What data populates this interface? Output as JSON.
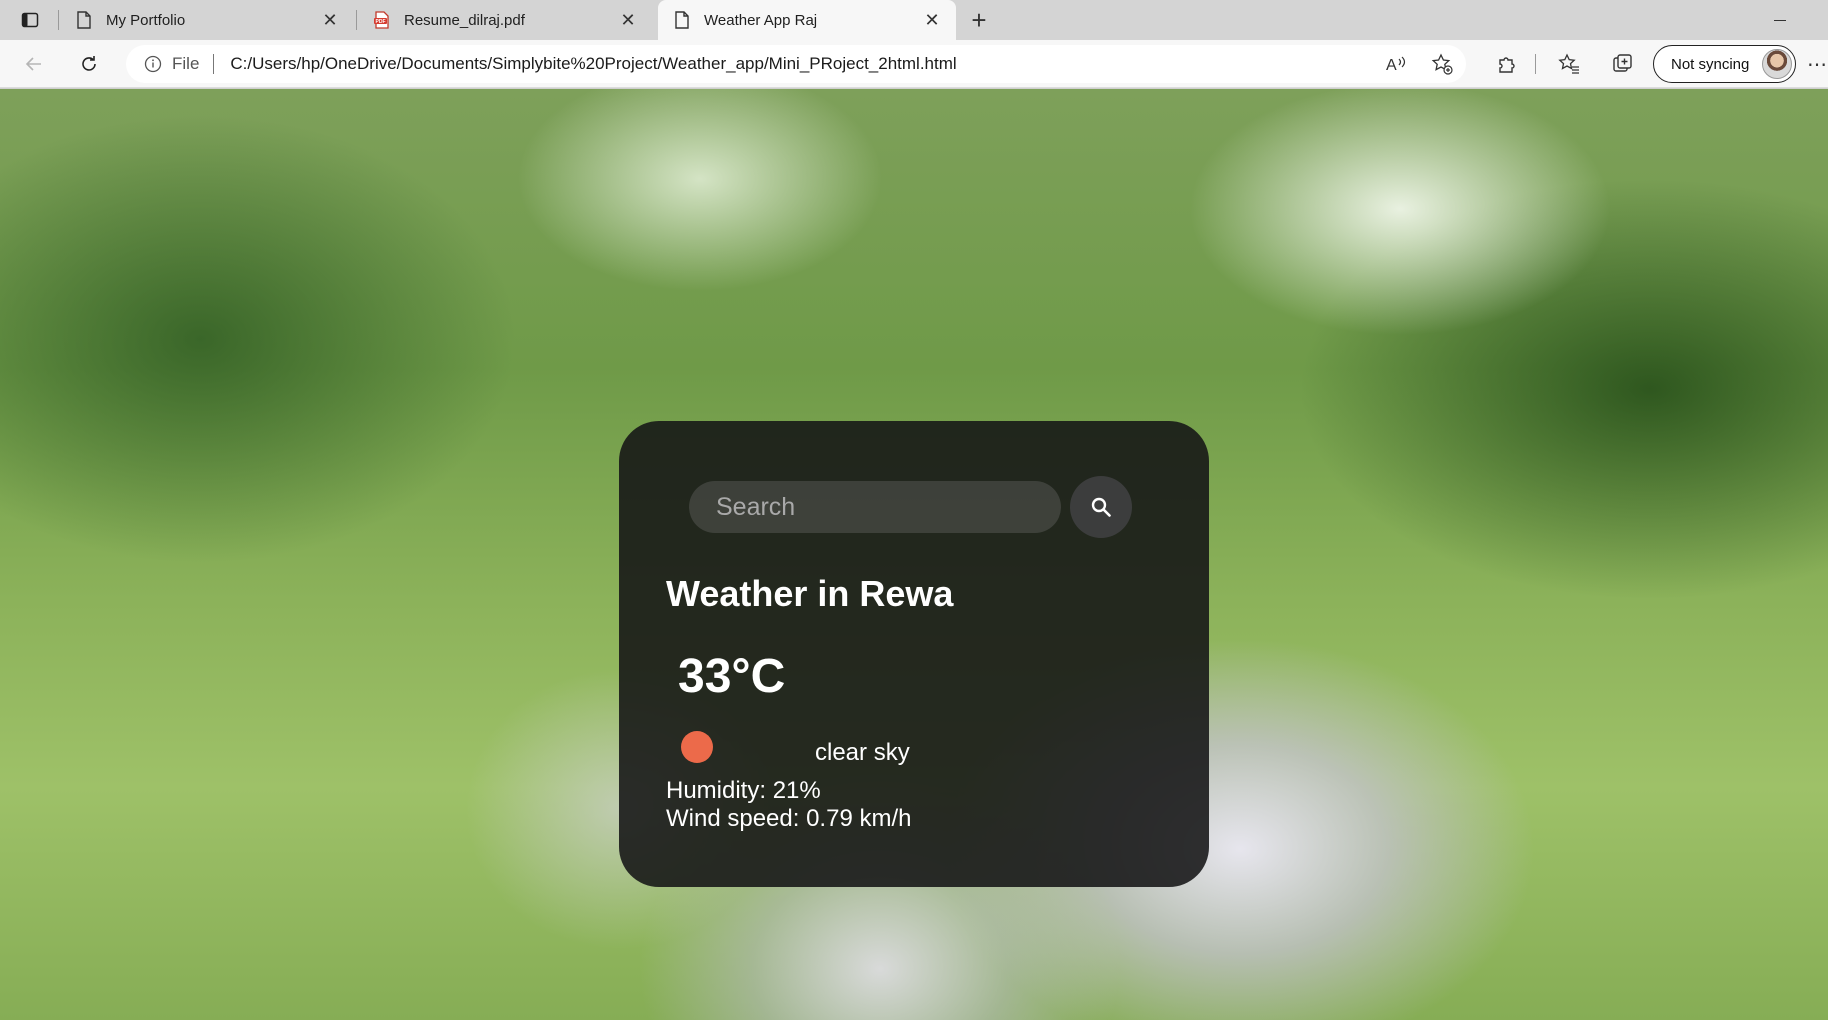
{
  "browser": {
    "tabs": [
      {
        "title": "My Portfolio",
        "icon": "page-icon",
        "active": false
      },
      {
        "title": "Resume_dilraj.pdf",
        "icon": "pdf-icon",
        "active": false
      },
      {
        "title": "Weather App Raj",
        "icon": "page-icon",
        "active": true
      }
    ],
    "address": {
      "scheme_label": "File",
      "url": "C:/Users/hp/OneDrive/Documents/Simplybite%20Project/Weather_app/Mini_PRoject_2html.html"
    },
    "profile_button_label": "Not syncing",
    "pdf_badge": "PDF"
  },
  "weather": {
    "search_placeholder": "Search",
    "title": "Weather in Rewa",
    "temperature": "33°C",
    "description": "clear sky",
    "humidity": "Humidity: 21%",
    "wind": "Wind speed: 0.79 km/h",
    "icon_color": "#ec6a4a"
  }
}
